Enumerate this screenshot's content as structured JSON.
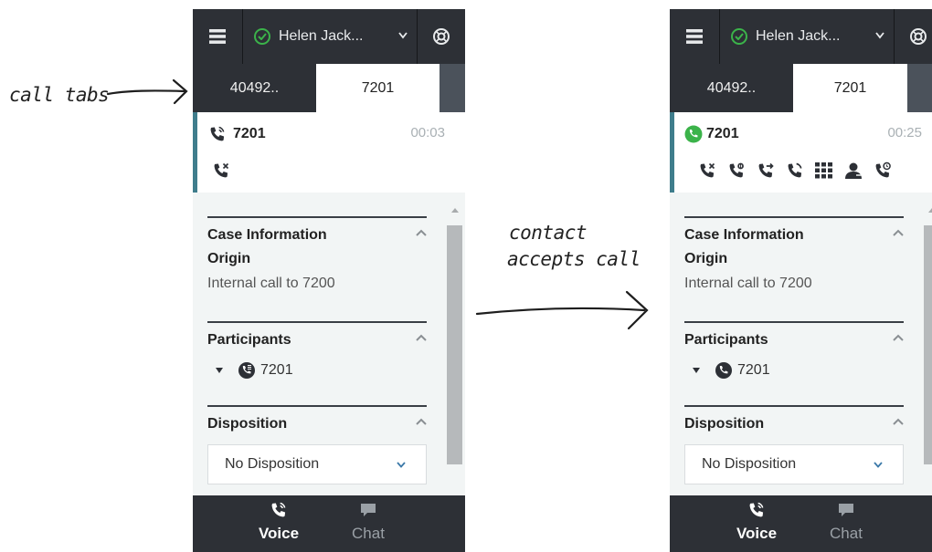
{
  "annotations": {
    "call_tabs": "call tabs",
    "contact_line1": "contact",
    "contact_line2": "accepts call"
  },
  "panels": [
    {
      "agent_name": "Helen Jack...",
      "agent_status": "ready",
      "tabs": [
        {
          "label": "40492..",
          "active": false
        },
        {
          "label": "7201",
          "active": true
        }
      ],
      "interaction": {
        "title": "7201",
        "timer": "00:03",
        "state": "ringing",
        "actions": [
          "end-call-icon"
        ]
      },
      "case_info": {
        "title": "Case Information",
        "origin_label": "Origin",
        "origin_value": "Internal call to 7200"
      },
      "participants": {
        "title": "Participants",
        "name": "7201",
        "icon": "ringing-phone-icon"
      },
      "disposition": {
        "title": "Disposition",
        "selected": "No Disposition"
      },
      "bottom": {
        "voice_label": "Voice",
        "chat_label": "Chat"
      }
    },
    {
      "agent_name": "Helen Jack...",
      "agent_status": "ready",
      "tabs": [
        {
          "label": "40492..",
          "active": false
        },
        {
          "label": "7201",
          "active": true
        }
      ],
      "interaction": {
        "title": "7201",
        "timer": "00:25",
        "state": "connected",
        "actions": [
          "end-call-icon",
          "hold-call-icon",
          "transfer-call-icon",
          "consult-call-icon",
          "keypad-icon",
          "conference-icon",
          "schedule-callback-icon"
        ]
      },
      "case_info": {
        "title": "Case Information",
        "origin_label": "Origin",
        "origin_value": "Internal call to 7200"
      },
      "participants": {
        "title": "Participants",
        "name": "7201",
        "icon": "connected-phone-icon"
      },
      "disposition": {
        "title": "Disposition",
        "selected": "No Disposition"
      },
      "bottom": {
        "voice_label": "Voice",
        "chat_label": "Chat"
      }
    }
  ],
  "colors": {
    "topbar": "#2d3036",
    "status_green": "#3bb34a",
    "interaction_accent": "#3f7d8c",
    "panel_bg": "#f2f5f5"
  }
}
